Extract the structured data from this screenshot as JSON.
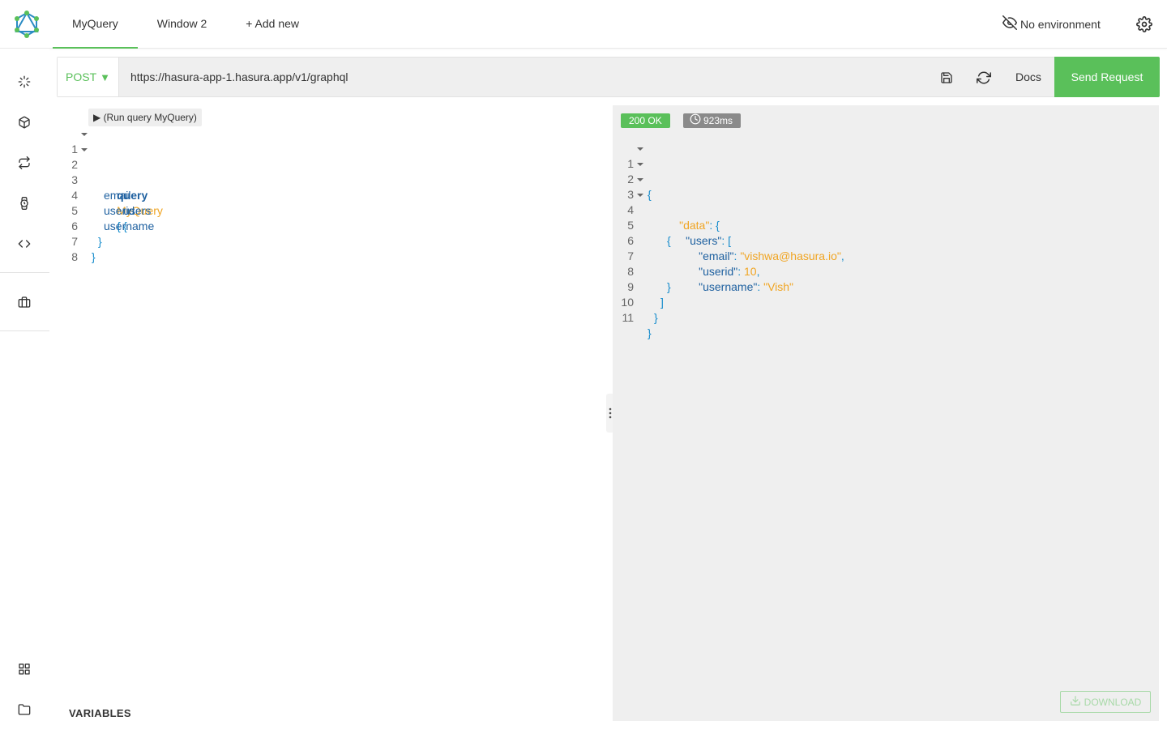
{
  "header": {
    "tabs": [
      {
        "label": "MyQuery",
        "active": true
      },
      {
        "label": "Window 2",
        "active": false
      },
      {
        "label": "+ Add new",
        "active": false
      }
    ],
    "environment_label": "No environment"
  },
  "sidebar": {
    "items": [
      {
        "icon": "spinner-icon"
      },
      {
        "icon": "cube-icon"
      },
      {
        "icon": "repeat-icon"
      },
      {
        "icon": "watch-icon"
      },
      {
        "icon": "code-icon"
      },
      {
        "icon": "briefcase-icon"
      },
      {
        "icon": "grid-icon"
      },
      {
        "icon": "folder-icon"
      }
    ]
  },
  "request": {
    "method": "POST",
    "url": "https://hasura-app-1.hasura.app/v1/graphql",
    "docs_label": "Docs",
    "send_label": "Send Request"
  },
  "editor": {
    "run_hint": "▶ (Run query MyQuery)",
    "line_numbers": [
      "1",
      "2",
      "3",
      "4",
      "5",
      "6",
      "7",
      "8"
    ],
    "query_keyword": "query",
    "operation_name": "MyQuery",
    "open_brace": "{",
    "root_field": "users",
    "fields": [
      "email",
      "userid",
      "username"
    ],
    "close_brace": "}",
    "variables_label": "VARIABLES"
  },
  "response": {
    "status": "200 OK",
    "time": "923ms",
    "line_numbers": [
      "1",
      "2",
      "3",
      "4",
      "5",
      "6",
      "7",
      "8",
      "9",
      "10",
      "11"
    ],
    "keys": {
      "data": "\"data\"",
      "users": "\"users\"",
      "email": "\"email\"",
      "userid": "\"userid\"",
      "username": "\"username\""
    },
    "values": {
      "email": "\"vishwa@hasura.io\"",
      "userid": "10",
      "username": "\"Vish\""
    },
    "download_label": "DOWNLOAD"
  },
  "colors": {
    "accent": "#5ac05a",
    "keyword": "#1f61a0",
    "definition": "#f0a523",
    "punctuation": "#168ccc"
  }
}
